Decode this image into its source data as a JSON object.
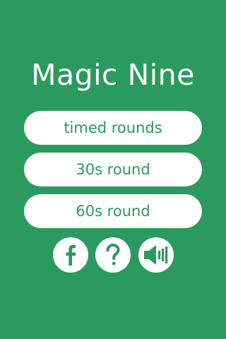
{
  "app": {
    "title": "Magic Nine"
  },
  "menu": {
    "timed_rounds_label": "timed rounds",
    "round_30_label": "30s round",
    "round_60_label": "60s round"
  },
  "icons": {
    "facebook": "facebook-icon",
    "help": "question-mark-icon",
    "sound": "speaker-volume-icon"
  },
  "colors": {
    "background": "#2a9a5e",
    "button_fill": "#ffffff",
    "button_text": "#2a9a5e"
  }
}
